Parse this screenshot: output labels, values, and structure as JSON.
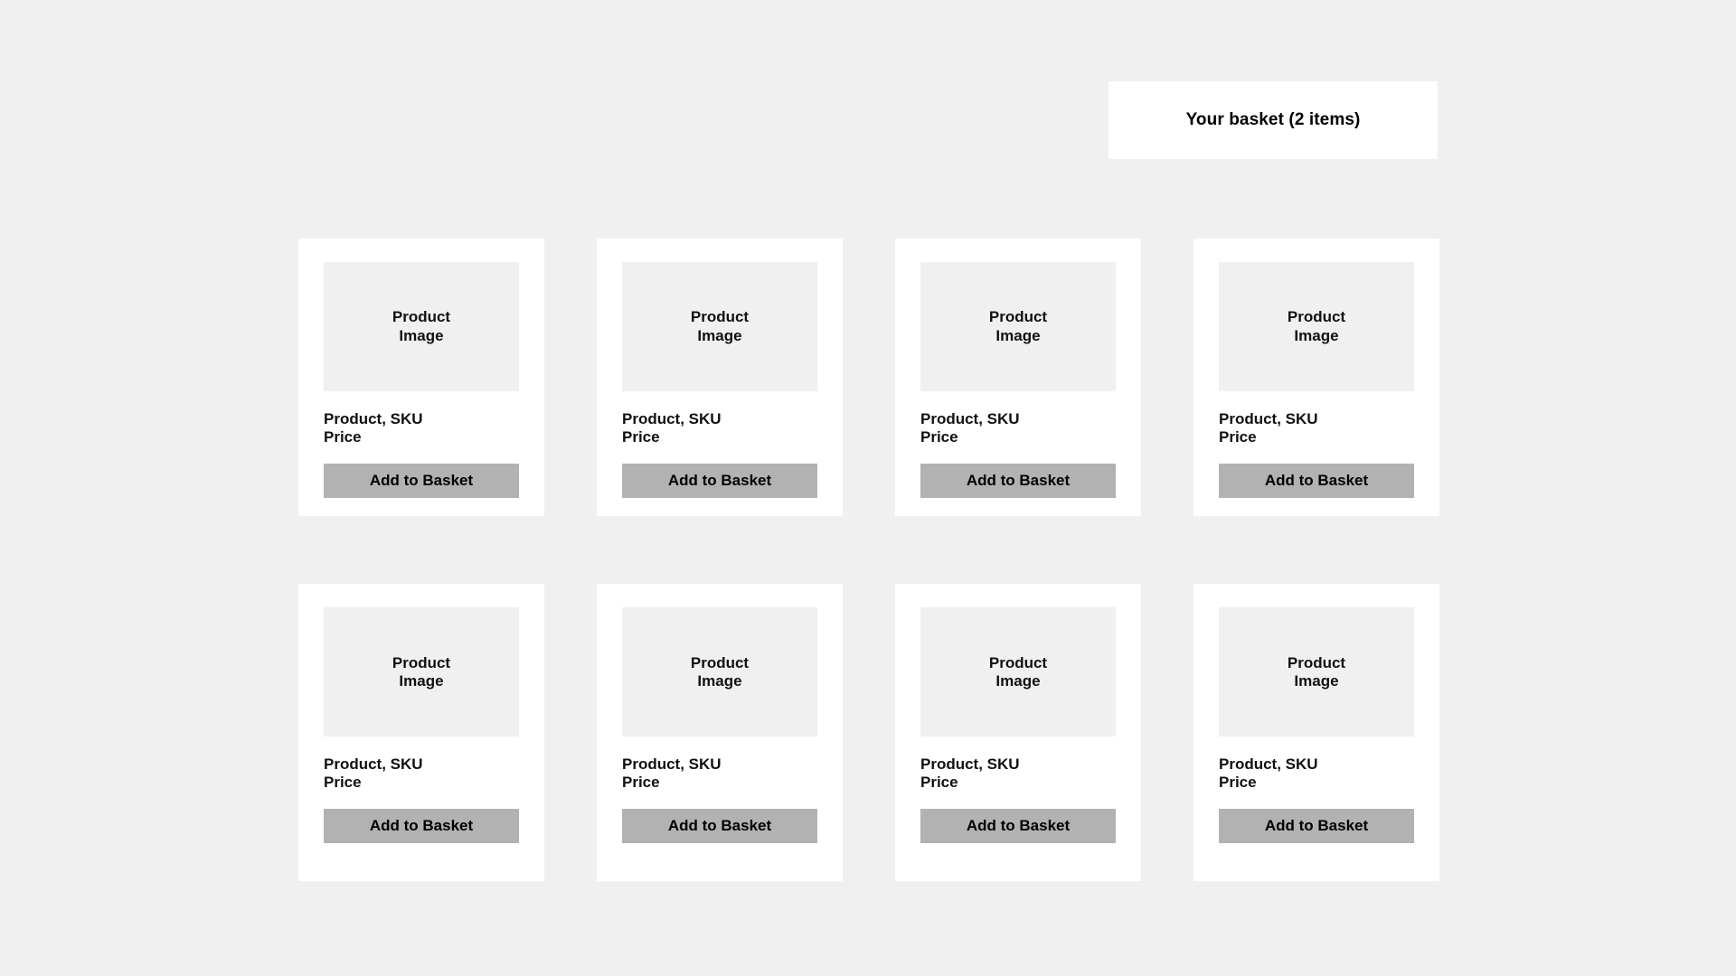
{
  "page": {
    "background_color": "#f0f0f0"
  },
  "basket": {
    "title": "Your basket (2 items)",
    "item_count": 2,
    "background_color": "#ffffff"
  },
  "grid": {
    "columns": 4,
    "rows": 2,
    "card_background": "#ffffff",
    "image_placeholder_color": "#f0f0f0",
    "button_color": "#b2b2b2"
  },
  "products": [
    {
      "image_line1": "Product",
      "image_line2": "Image",
      "name": "Product, SKU",
      "price": "Price",
      "button_label": "Add to Basket"
    },
    {
      "image_line1": "Product",
      "image_line2": "Image",
      "name": "Product, SKU",
      "price": "Price",
      "button_label": "Add to Basket"
    },
    {
      "image_line1": "Product",
      "image_line2": "Image",
      "name": "Product, SKU",
      "price": "Price",
      "button_label": "Add to Basket"
    },
    {
      "image_line1": "Product",
      "image_line2": "Image",
      "name": "Product, SKU",
      "price": "Price",
      "button_label": "Add to Basket"
    },
    {
      "image_line1": "Product",
      "image_line2": "Image",
      "name": "Product, SKU",
      "price": "Price",
      "button_label": "Add to Basket"
    },
    {
      "image_line1": "Product",
      "image_line2": "Image",
      "name": "Product, SKU",
      "price": "Price",
      "button_label": "Add to Basket"
    },
    {
      "image_line1": "Product",
      "image_line2": "Image",
      "name": "Product, SKU",
      "price": "Price",
      "button_label": "Add to Basket"
    },
    {
      "image_line1": "Product",
      "image_line2": "Image",
      "name": "Product, SKU",
      "price": "Price",
      "button_label": "Add to Basket"
    }
  ]
}
